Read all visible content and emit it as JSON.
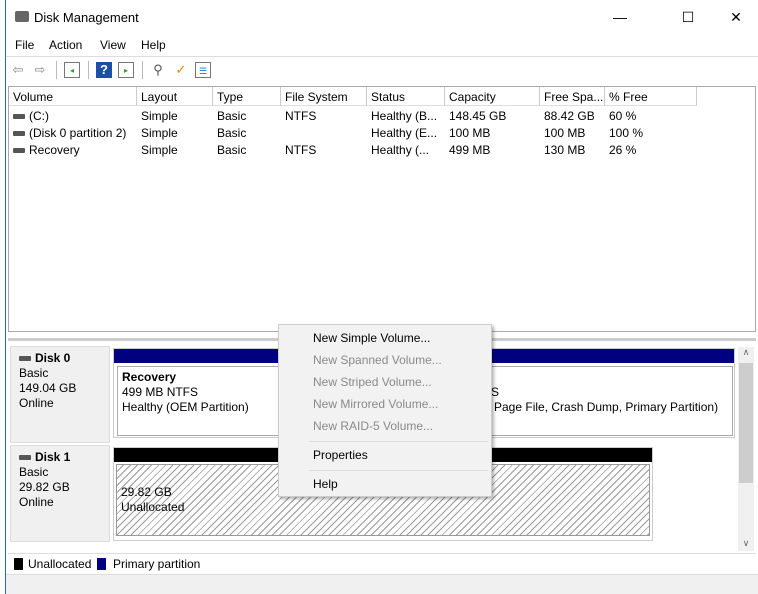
{
  "window": {
    "title": "Disk Management",
    "minimize": "—",
    "maximize": "☐",
    "close": "✕"
  },
  "menu": [
    "File",
    "Action",
    "View",
    "Help"
  ],
  "toolbar": [
    "back-icon",
    "forward-icon",
    "console-tree-icon",
    "help-icon",
    "show-action-pane-icon",
    "connect-icon",
    "properties-icon",
    "settings-list-icon"
  ],
  "columns": [
    "Volume",
    "Layout",
    "Type",
    "File System",
    "Status",
    "Capacity",
    "Free Spa...",
    "% Free"
  ],
  "volumes": [
    {
      "volume": "(C:)",
      "layout": "Simple",
      "type": "Basic",
      "fs": "NTFS",
      "status": "Healthy (B...",
      "capacity": "148.45 GB",
      "free": "88.42 GB",
      "pct": "60 %"
    },
    {
      "volume": "(Disk 0 partition 2)",
      "layout": "Simple",
      "type": "Basic",
      "fs": "",
      "status": "Healthy (E...",
      "capacity": "100 MB",
      "free": "100 MB",
      "pct": "100 %"
    },
    {
      "volume": "Recovery",
      "layout": "Simple",
      "type": "Basic",
      "fs": "NTFS",
      "status": "Healthy (...",
      "capacity": "499 MB",
      "free": "130 MB",
      "pct": "26 %"
    }
  ],
  "disks": [
    {
      "name": "Disk 0",
      "type": "Basic",
      "size": "149.04 GB",
      "state": "Online",
      "recovery": {
        "name": "Recovery",
        "info": "499 MB NTFS",
        "status": "Healthy (OEM Partition)"
      },
      "c_fragment1": "S",
      "c_fragment2": "Page File, Crash Dump, Primary Partition)"
    },
    {
      "name": "Disk 1",
      "type": "Basic",
      "size": "29.82 GB",
      "state": "Online",
      "unalloc": {
        "size": "29.82 GB",
        "label": "Unallocated"
      }
    }
  ],
  "context_menu": {
    "items": [
      "New Simple Volume...",
      "New Spanned Volume...",
      "New Striped Volume...",
      "New Mirrored Volume...",
      "New RAID-5 Volume..."
    ],
    "properties": "Properties",
    "help": "Help"
  },
  "legend": {
    "unallocated": "Unallocated",
    "primary": "Primary partition",
    "colors": {
      "unallocated": "#000000",
      "primary": "#000080"
    }
  }
}
